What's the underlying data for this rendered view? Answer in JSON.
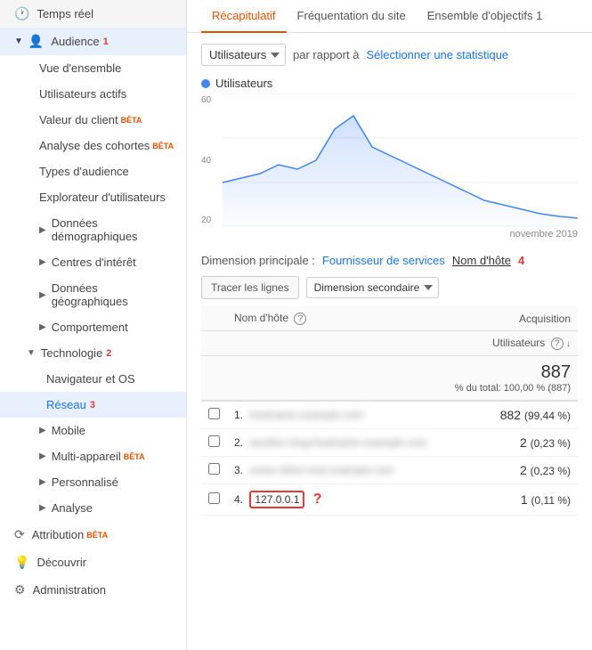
{
  "sidebar": {
    "temps_reel": "Temps réel",
    "audience": "Audience",
    "audience_number": "1",
    "vue_ensemble": "Vue d'ensemble",
    "utilisateurs_actifs": "Utilisateurs actifs",
    "valeur_client": "Valeur du client",
    "valeur_badge": "BÊTA",
    "analyse_cohortes": "Analyse des cohortes",
    "analyse_badge": "BÊTA",
    "types_audience": "Types d'audience",
    "explorateur": "Explorateur d'utilisateurs",
    "donnees_demo": "Données démographiques",
    "centres_interet": "Centres d'intérêt",
    "donnees_geo": "Données géographiques",
    "comportement": "Comportement",
    "technologie": "Technologie",
    "technologie_number": "2",
    "navigateur_os": "Navigateur et OS",
    "reseau": "Réseau",
    "reseau_number": "3",
    "mobile": "Mobile",
    "multi_appareil": "Multi-appareil",
    "multi_badge": "BÊTA",
    "personnalise": "Personnalisé",
    "analyse": "Analyse",
    "attribution": "Attribution",
    "attribution_badge": "BÊTA",
    "decouvrir": "Découvrir",
    "administration": "Administration"
  },
  "main": {
    "tabs": [
      "Récapitulatif",
      "Fréquentation du site",
      "Ensemble d'objectifs 1"
    ],
    "active_tab": "Récapitulatif",
    "dropdown_option": "Utilisateurs",
    "par_rapport": "par rapport à",
    "select_stat": "Sélectionner une statistique",
    "chart_legend": "Utilisateurs",
    "chart_y_labels": [
      "60",
      "40",
      "20"
    ],
    "chart_x_label": "novembre 2019",
    "dimension_label": "Dimension principale :",
    "dim_option1": "Fournisseur de services",
    "dim_option2": "Nom d'hôte",
    "dim_number": "4",
    "tracer_btn": "Tracer les lignes",
    "dim_secondary": "Dimension secondaire",
    "table": {
      "col_checkbox": "",
      "col_hostname": "Nom d'hôte",
      "col_acquisition": "Acquisition",
      "col_users": "Utilisateurs",
      "total_users": "887",
      "total_pct": "% du total: 100,00 % (887)",
      "rows": [
        {
          "num": "1.",
          "hostname": "blurred1",
          "users_val": "882",
          "users_pct": "(99,44 %)"
        },
        {
          "num": "2.",
          "hostname": "blurred2",
          "users_val": "2",
          "users_pct": "(0,23 %)"
        },
        {
          "num": "3.",
          "hostname": "blurred3",
          "users_val": "2",
          "users_pct": "(0,23 %)"
        },
        {
          "num": "4.",
          "hostname": "127.0.0.1",
          "users_val": "1",
          "users_pct": "(0,11 %)"
        }
      ]
    }
  },
  "colors": {
    "accent_red": "#e53935",
    "accent_orange": "#e65100",
    "link_blue": "#1a73e8",
    "active_bg": "#e8f0fe",
    "chart_blue": "#4285f4",
    "chart_fill": "rgba(66,133,244,0.15)"
  }
}
